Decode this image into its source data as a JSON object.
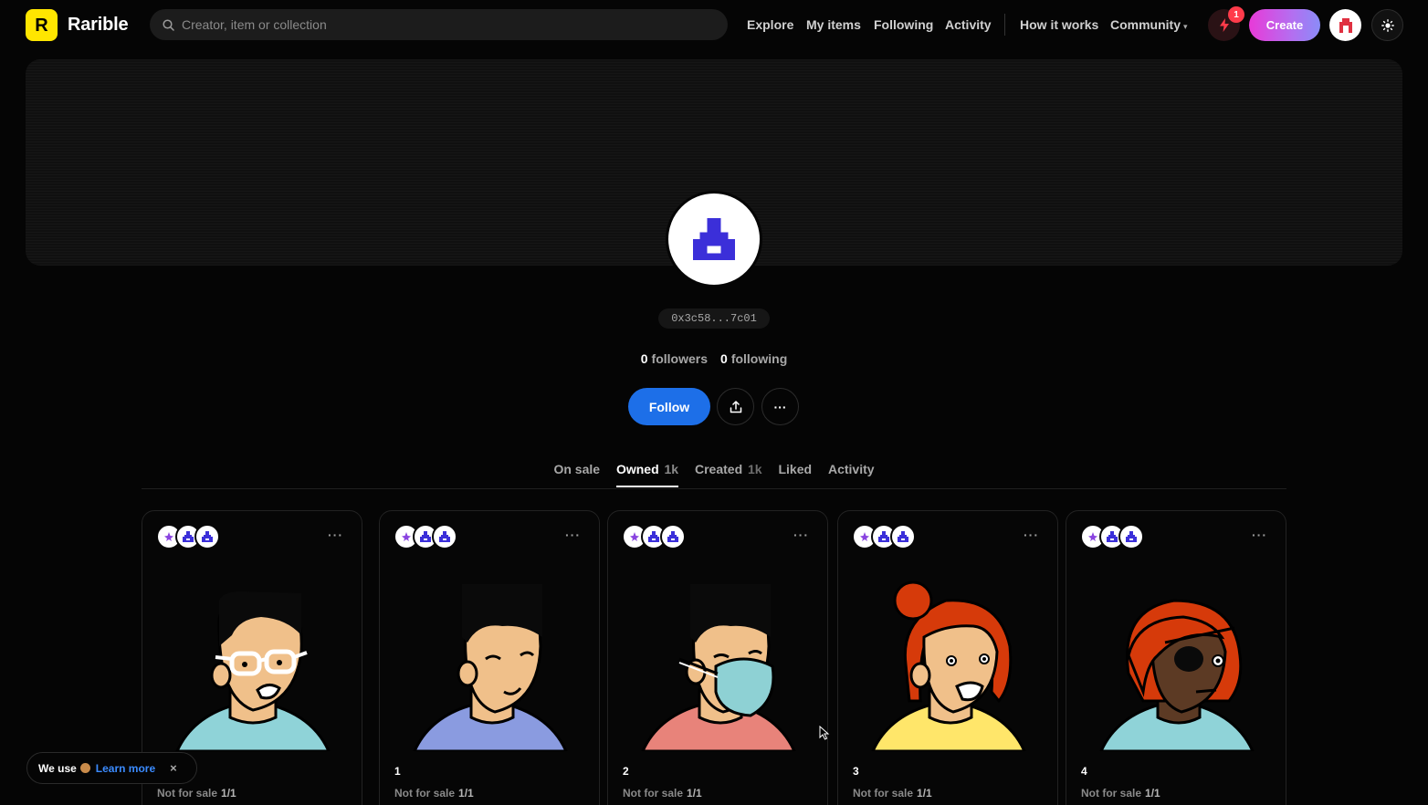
{
  "header": {
    "brand": "Rarible",
    "logo_letter": "R",
    "search_placeholder": "Creator, item or collection",
    "nav": [
      "Explore",
      "My items",
      "Following",
      "Activity",
      "How it works",
      "Community"
    ],
    "notification_count": "1",
    "create_label": "Create"
  },
  "profile": {
    "address": "0x3c58...7c01",
    "followers_count": "0",
    "followers_label": "followers",
    "following_count": "0",
    "following_label": "following",
    "follow_label": "Follow",
    "more_label": "···"
  },
  "tabs": [
    {
      "label": "On sale",
      "count": ""
    },
    {
      "label": "Owned",
      "count": "1k"
    },
    {
      "label": "Created",
      "count": "1k"
    },
    {
      "label": "Liked",
      "count": ""
    },
    {
      "label": "Activity",
      "count": ""
    }
  ],
  "cards": [
    {
      "title": "",
      "status": "Not for sale",
      "edition": "1/1"
    },
    {
      "title": "1",
      "status": "Not for sale",
      "edition": "1/1"
    },
    {
      "title": "2",
      "status": "Not for sale",
      "edition": "1/1"
    },
    {
      "title": "3",
      "status": "Not for sale",
      "edition": "1/1"
    },
    {
      "title": "4",
      "status": "Not for sale",
      "edition": "1/1"
    }
  ],
  "card_menu_label": "···",
  "cookie": {
    "text": "We use",
    "link": "Learn more",
    "close": "×"
  },
  "colors": {
    "accent_blue": "#1d6fe8",
    "logo_yellow": "#ffe600",
    "create_gradient_start": "#e83ad8",
    "create_gradient_end": "#8a8cf8",
    "avatar_purple": "#3b2fd9"
  }
}
